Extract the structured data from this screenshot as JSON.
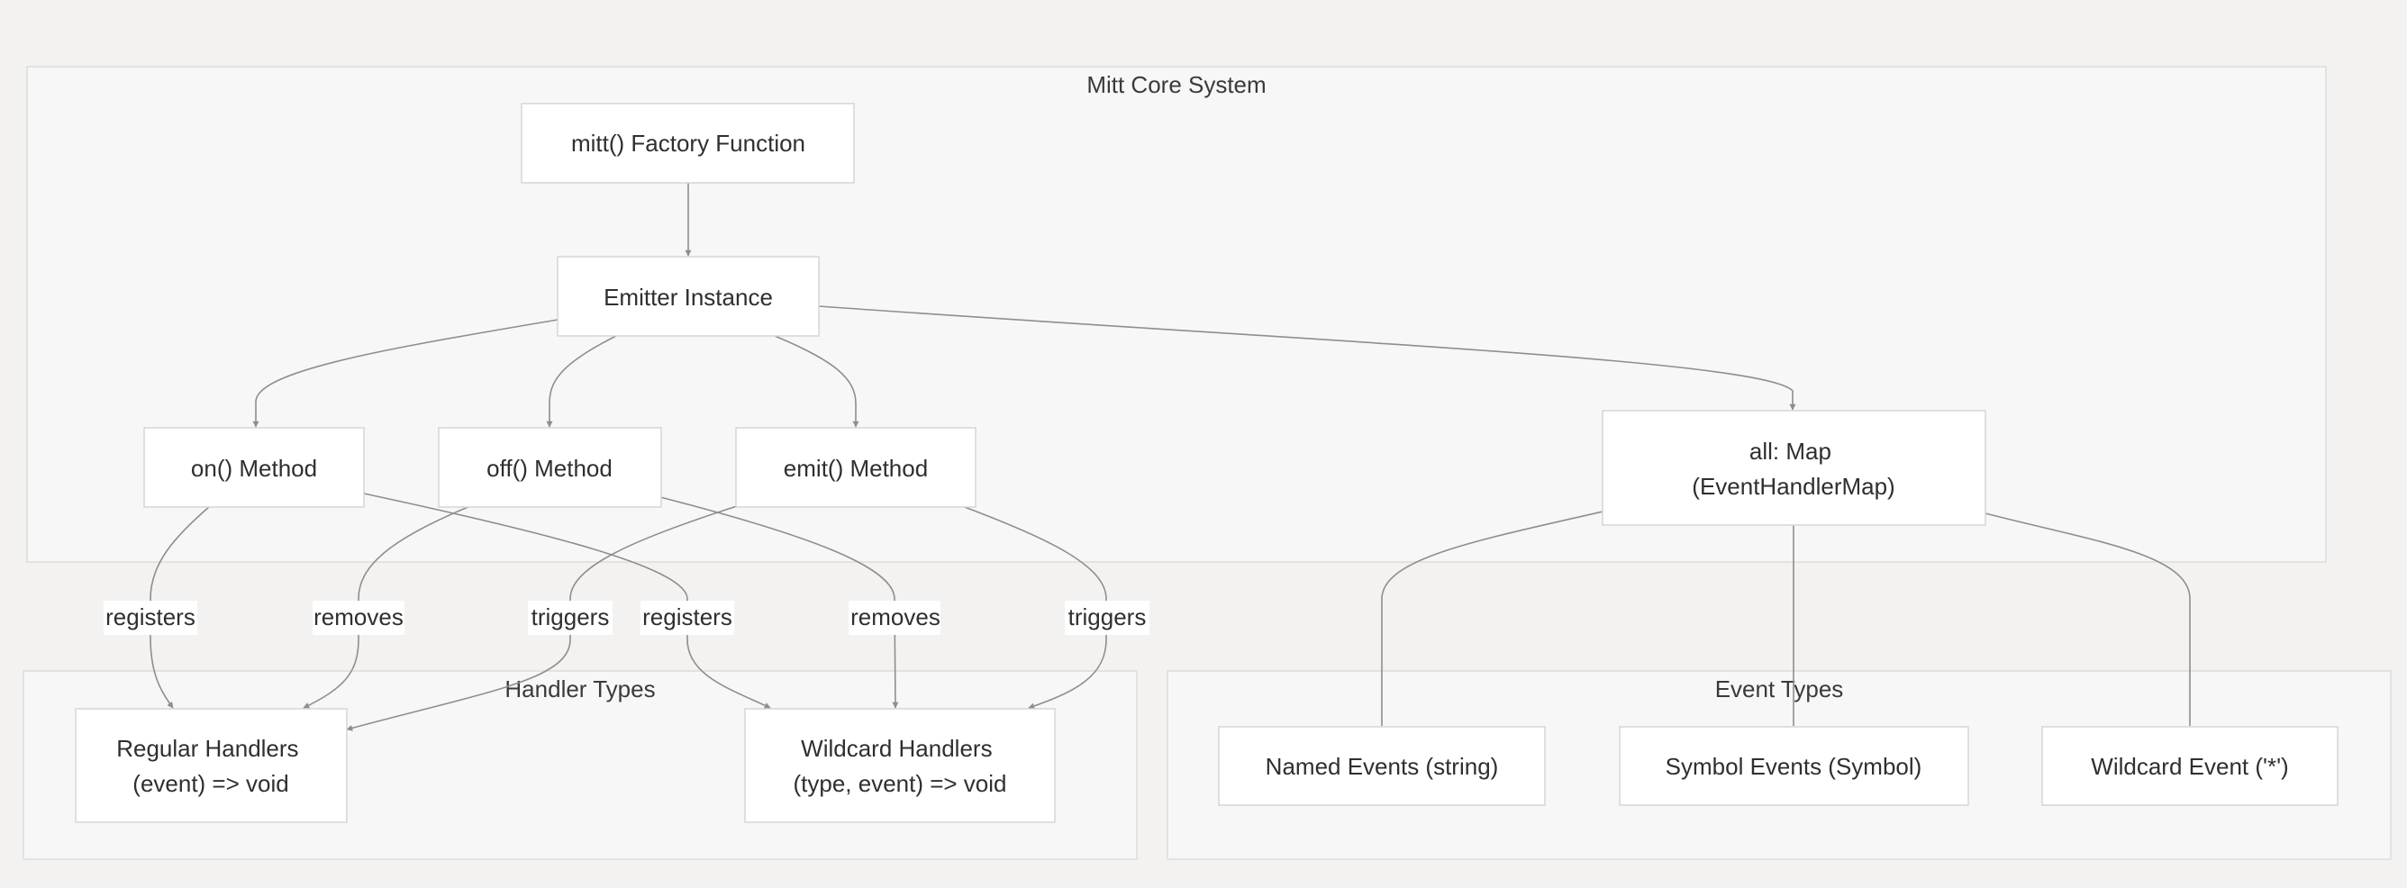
{
  "clusters": {
    "core": {
      "title": "Mitt Core System"
    },
    "handlers": {
      "title": "Handler Types"
    },
    "events": {
      "title": "Event Types"
    }
  },
  "nodes": {
    "factory": {
      "lines": [
        "mitt() Factory Function"
      ]
    },
    "emitter": {
      "lines": [
        "Emitter Instance"
      ]
    },
    "on": {
      "lines": [
        "on() Method"
      ]
    },
    "off": {
      "lines": [
        "off() Method"
      ]
    },
    "emit": {
      "lines": [
        "emit() Method"
      ]
    },
    "all": {
      "lines": [
        "all: Map",
        "(EventHandlerMap)"
      ]
    },
    "regular": {
      "lines": [
        "Regular Handlers",
        "(event) => void"
      ]
    },
    "wildcard_handlers": {
      "lines": [
        "Wildcard Handlers",
        "(type, event) => void"
      ]
    },
    "named": {
      "lines": [
        "Named Events (string)"
      ]
    },
    "symbol": {
      "lines": [
        "Symbol Events (Symbol)"
      ]
    },
    "wildcard_event": {
      "lines": [
        "Wildcard Event ('*')"
      ]
    }
  },
  "edge_labels": {
    "on_regular": "registers",
    "off_regular": "removes",
    "emit_regular": "triggers",
    "on_wildcard": "registers",
    "off_wildcard": "removes",
    "emit_wildcard": "triggers"
  }
}
